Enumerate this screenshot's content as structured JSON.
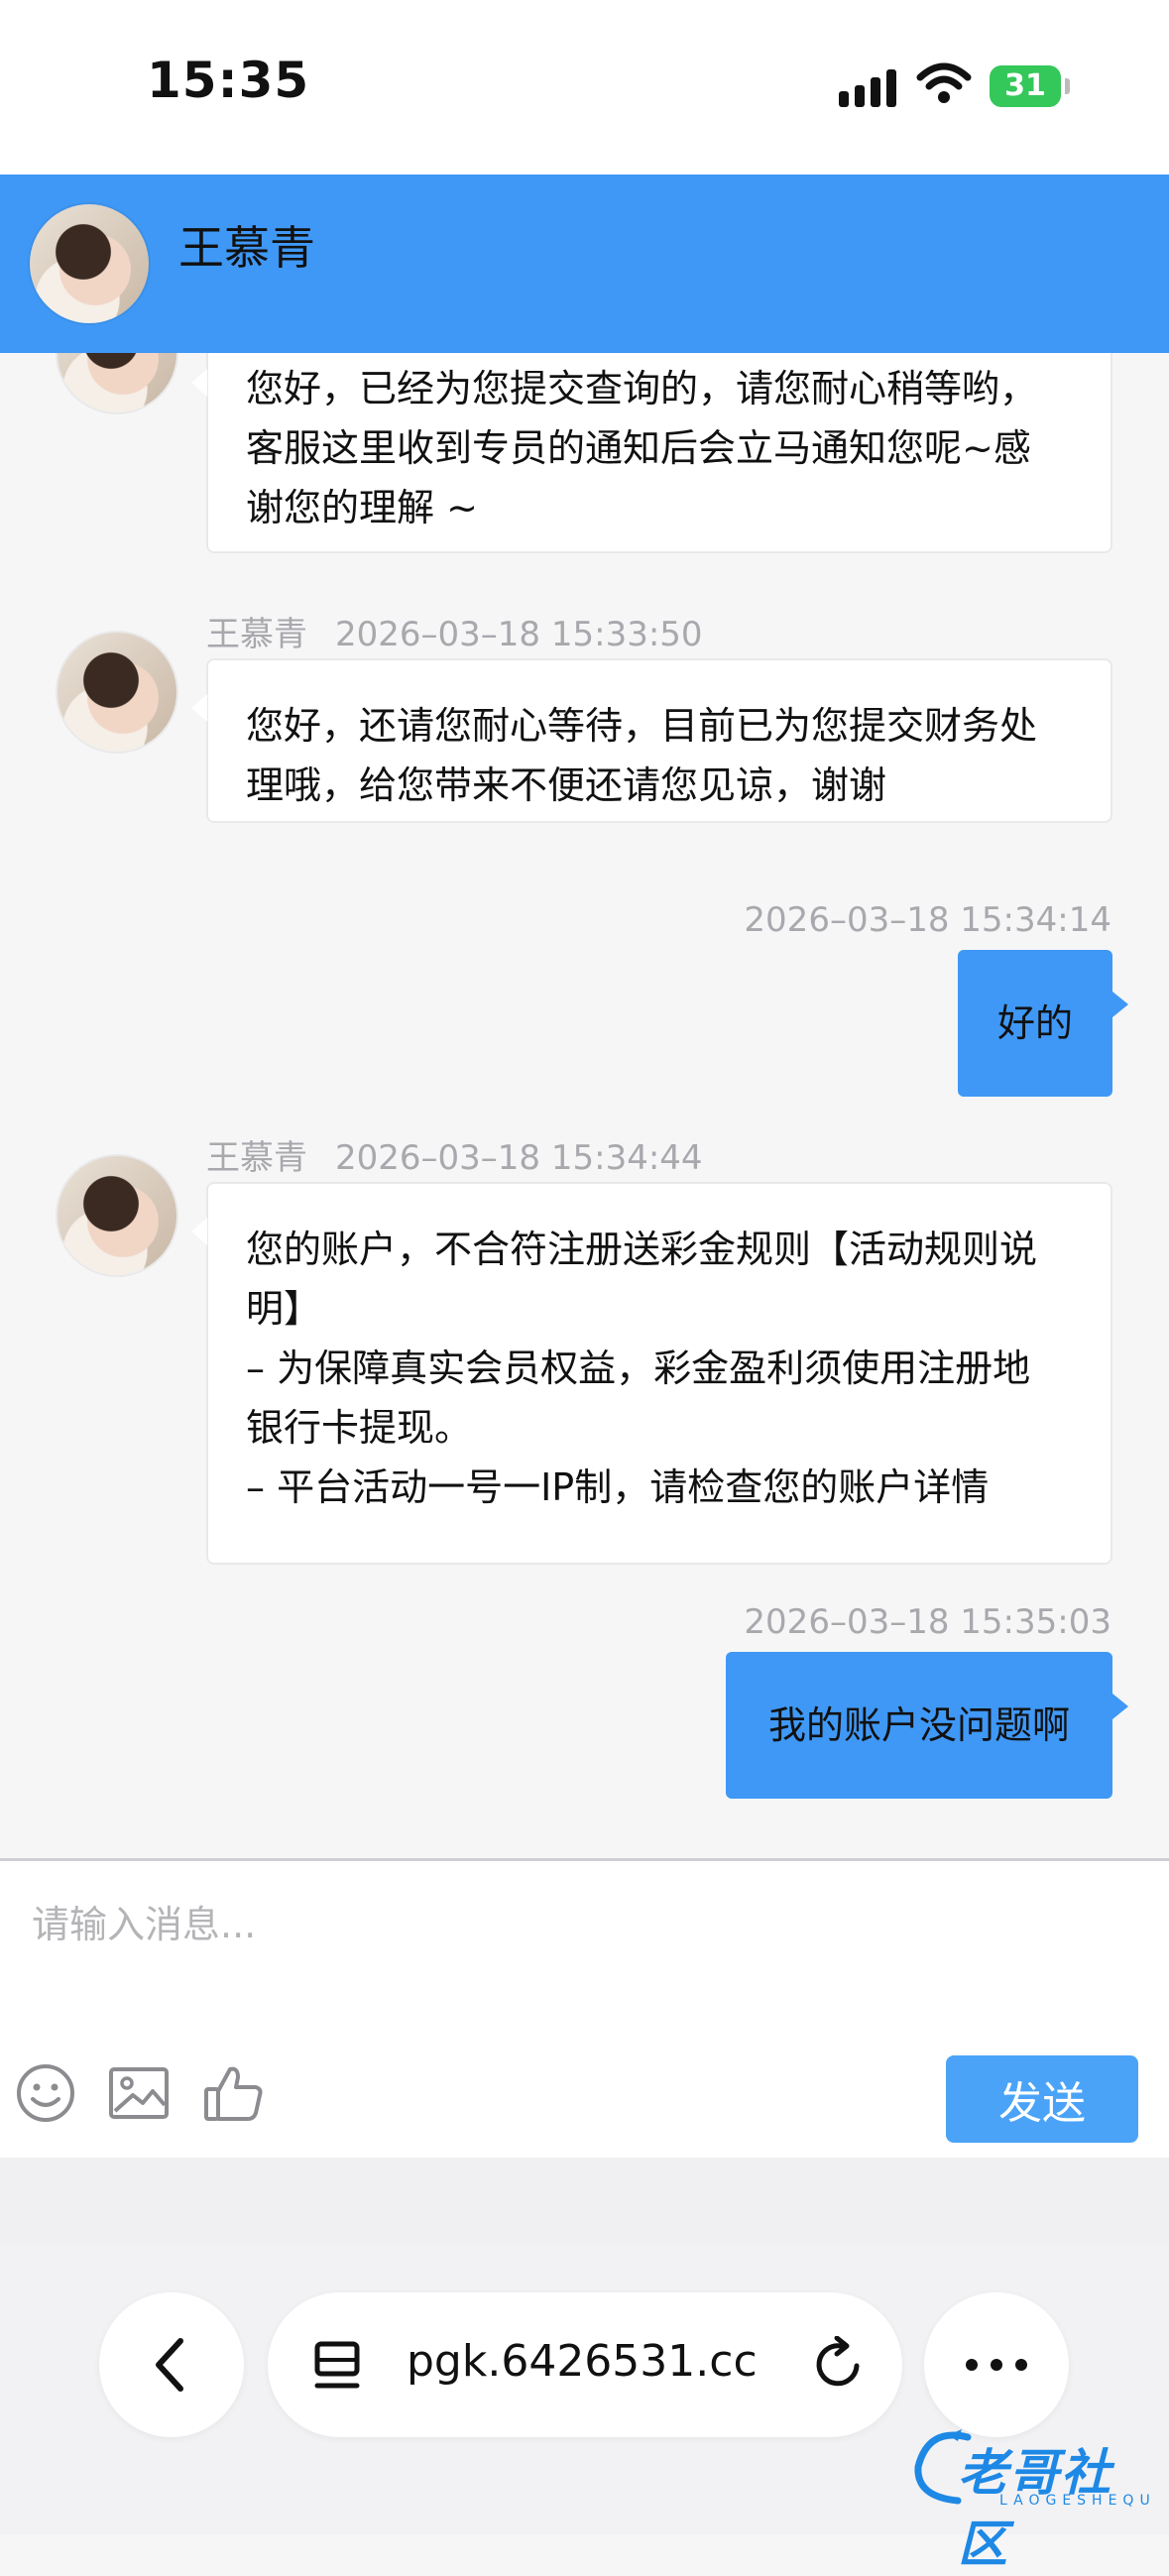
{
  "status_bar": {
    "time": "15:35",
    "battery": "31"
  },
  "header": {
    "contact_name": "王慕青"
  },
  "messages": [
    {
      "lines": [
        "您好，已经为您提交查询的，请您耐心稍等哟，",
        "客服这里收到专员的通知后会立马通知您呢~感",
        "谢您的理解 ~"
      ]
    },
    {
      "name": "王慕青",
      "time": "2026–03–18 15:33:50",
      "lines": [
        "您好，还请您耐心等待，目前已为您提交财务处",
        "理哦，给您带来不便还请您见谅，谢谢"
      ]
    },
    {
      "time": "2026–03–18 15:34:14",
      "text": "好的"
    },
    {
      "name": "王慕青",
      "time": "2026–03–18 15:34:44",
      "lines": [
        "您的账户，不合符注册送彩金规则【活动规则说",
        "明】",
        "– 为保障真实会员权益，彩金盈利须使用注册地",
        "银行卡提现。",
        "– 平台活动一号一IP制，请检查您的账户详情"
      ]
    },
    {
      "time": "2026–03–18 15:35:03",
      "text": "我的账户没问题啊"
    }
  ],
  "composer": {
    "placeholder": "请输入消息...",
    "send_label": "发送"
  },
  "browser": {
    "url": "pgk.6426531.cc"
  },
  "watermark": {
    "text": "老哥社区",
    "sub": "LAOGESHEQU"
  },
  "colors": {
    "accent": "#3f98f5",
    "send": "#4aa3f7"
  }
}
